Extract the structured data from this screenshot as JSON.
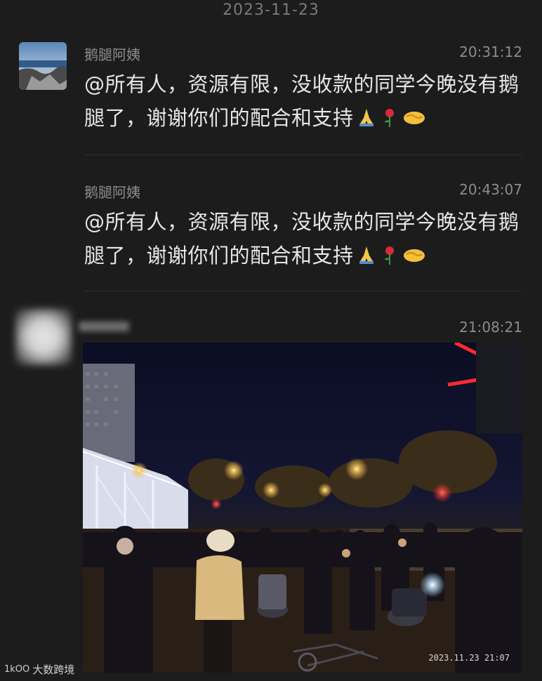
{
  "date_separator": "2023-11-23",
  "messages": [
    {
      "sender": "鹅腿阿姨",
      "time": "20:31:12",
      "text": "@所有人，资源有限，没收款的同学今晚没有鹅腿了，谢谢你们的配合和支持",
      "emojis": [
        "folded-hands",
        "rose",
        "handshake"
      ]
    },
    {
      "sender": "鹅腿阿姨",
      "time": "20:43:07",
      "text": "@所有人，资源有限，没收款的同学今晚没有鹅腿了，谢谢你们的配合和支持",
      "emojis": [
        "folded-hands",
        "rose",
        "handshake"
      ]
    },
    {
      "sender": "",
      "time": "21:08:21",
      "photo": {
        "stamp": "2023.11.23  21:07",
        "description_icon": "crowd-night-photo"
      }
    }
  ],
  "watermark": {
    "logo": "1kOO",
    "text": "大数跨境"
  }
}
